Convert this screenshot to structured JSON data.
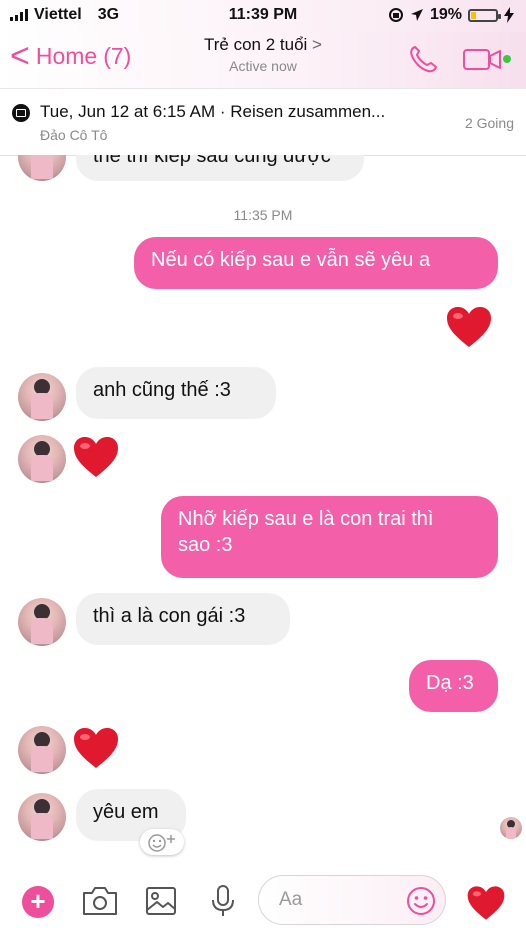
{
  "status_bar": {
    "carrier": "Viettel",
    "network": "3G",
    "time": "11:39 PM",
    "battery": "19%",
    "battery_level": 0.19
  },
  "nav": {
    "back_label": "Home",
    "back_count": "(7)",
    "chevron": "<",
    "title": "Trẻ con 2 tuổi",
    "title_chevron": ">",
    "subtitle": "Active now"
  },
  "event": {
    "title": "Tue, Jun 12 at 6:15 AM · Reisen zusammen...",
    "location": "Đảo Cô Tô",
    "going": "2 Going"
  },
  "messages": {
    "m0": "thế thì kiếp sau cũng được",
    "timestamp": "11:35 PM",
    "m1": "Nếu có kiếp sau e vẫn sẽ yêu a",
    "m2": "anh cũng thế :3",
    "m3a": "Nhỡ kiếp sau e là con trai thì",
    "m3b": "sao :3",
    "m4": "thì a là con gái :3",
    "m5": "Dạ :3",
    "m6": "yêu em"
  },
  "composer": {
    "placeholder": "Aa",
    "plus": "+"
  },
  "colors": {
    "accent": "#ee4e9b",
    "outgoing_bubble": "#f35fa8",
    "incoming_bubble": "#f0f0f0",
    "heart": "#e0192f"
  },
  "icons": [
    "signal-icon",
    "location-arrow-icon",
    "battery-icon",
    "charging-icon",
    "back-chevron-icon",
    "phone-icon",
    "video-camera-icon",
    "calendar-icon",
    "heart-icon",
    "camera-icon",
    "image-icon",
    "microphone-icon",
    "smile-icon",
    "add-reaction-icon",
    "plus-icon"
  ]
}
